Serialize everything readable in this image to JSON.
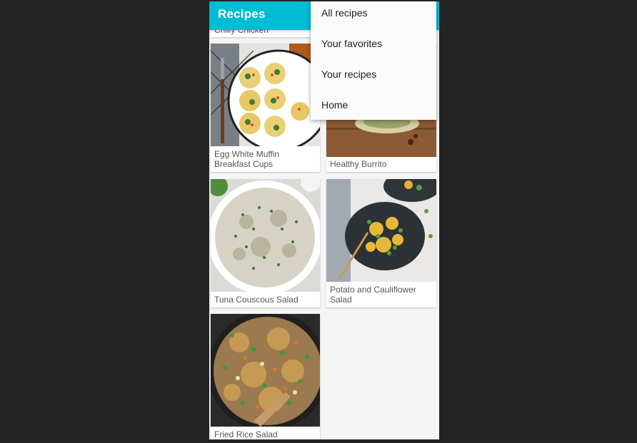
{
  "app_bar": {
    "title": "Recipes"
  },
  "menu": {
    "items": [
      {
        "label": "All recipes"
      },
      {
        "label": "Your favorites"
      },
      {
        "label": "Your recipes"
      },
      {
        "label": "Home"
      }
    ]
  },
  "recipes": [
    {
      "title": "Chilly Chicken"
    },
    {
      "title": "Egg White Muffin Breakfast Cups"
    },
    {
      "title": "Healthy Burrito"
    },
    {
      "title": "Tuna Couscous Salad"
    },
    {
      "title": "Potato and Cauliflower Salad"
    },
    {
      "title": "Fried Rice Salad"
    }
  ],
  "colors": {
    "app_bar": "#00bcd4",
    "background": "#f5f5f5",
    "surround": "#232323"
  }
}
